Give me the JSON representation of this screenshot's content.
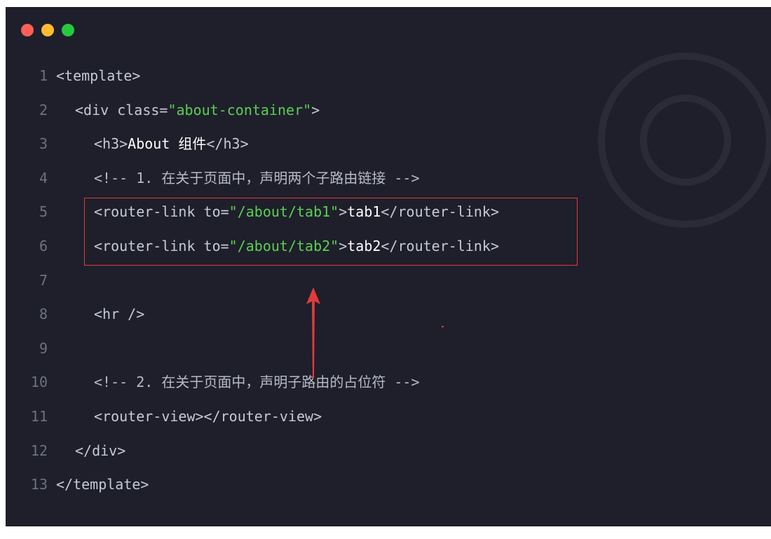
{
  "window": {
    "traffic_lights": {
      "close": "#ff5f56",
      "minimize": "#ffbd2e",
      "maximize": "#27c93f"
    }
  },
  "colors": {
    "background": "#1e1f2b",
    "tag": "#c6c9d6",
    "string": "#5bcf52",
    "text": "#ffffff",
    "comment": "#b7bac5",
    "highlight": "#e23a3a"
  },
  "code_lines": [
    {
      "num": "1",
      "segments": [
        {
          "k": "t",
          "v": "<template>"
        }
      ]
    },
    {
      "num": "2",
      "segments": [
        {
          "k": "t",
          "v": "<div class="
        },
        {
          "k": "s",
          "v": "\"about-container\""
        },
        {
          "k": "t",
          "v": ">"
        }
      ]
    },
    {
      "num": "3",
      "segments": [
        {
          "k": "t",
          "v": "<h3>"
        },
        {
          "k": "w",
          "v": "About 组件"
        },
        {
          "k": "t",
          "v": "</h3>"
        }
      ]
    },
    {
      "num": "4",
      "segments": [
        {
          "k": "c",
          "v": "<!-- 1. 在关于页面中，声明两个子路由链接 -->"
        }
      ]
    },
    {
      "num": "5",
      "segments": [
        {
          "k": "t",
          "v": "<router-link to="
        },
        {
          "k": "s",
          "v": "\"/about/tab1\""
        },
        {
          "k": "t",
          "v": ">"
        },
        {
          "k": "w",
          "v": "tab1"
        },
        {
          "k": "t",
          "v": "</router-link>"
        }
      ]
    },
    {
      "num": "6",
      "segments": [
        {
          "k": "t",
          "v": "<router-link to="
        },
        {
          "k": "s",
          "v": "\"/about/tab2\""
        },
        {
          "k": "t",
          "v": ">"
        },
        {
          "k": "w",
          "v": "tab2"
        },
        {
          "k": "t",
          "v": "</router-link>"
        }
      ]
    },
    {
      "num": "7",
      "segments": []
    },
    {
      "num": "8",
      "segments": [
        {
          "k": "t",
          "v": "<hr />"
        }
      ]
    },
    {
      "num": "9",
      "segments": []
    },
    {
      "num": "10",
      "segments": [
        {
          "k": "c",
          "v": "<!-- 2. 在关于页面中，声明子路由的占位符 -->"
        }
      ]
    },
    {
      "num": "11",
      "segments": [
        {
          "k": "t",
          "v": "<router-view></router-view>"
        }
      ]
    },
    {
      "num": "12",
      "segments": [
        {
          "k": "t",
          "v": "</div>"
        }
      ]
    },
    {
      "num": "13",
      "segments": [
        {
          "k": "t",
          "v": "</template>"
        }
      ]
    }
  ]
}
